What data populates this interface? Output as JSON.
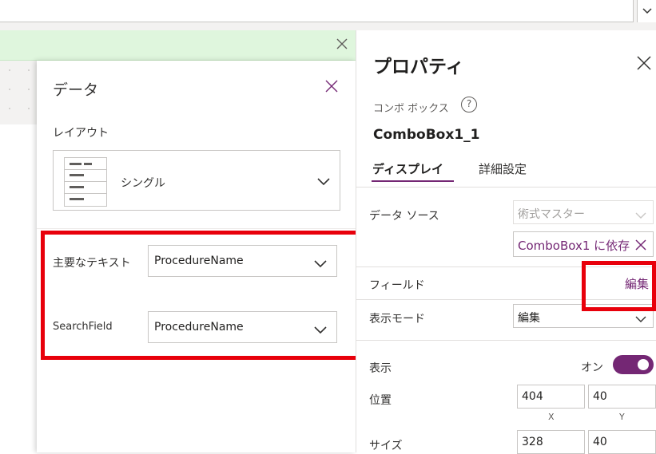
{
  "data_panel": {
    "title": "データ",
    "layout_label": "レイアウト",
    "layout_value": "シングル",
    "fields": [
      {
        "label": "主要なテキスト",
        "value": "ProcedureName"
      },
      {
        "label": "SearchField",
        "value": "ProcedureName"
      }
    ]
  },
  "properties": {
    "title": "プロパティ",
    "control_type": "コンボ ボックス",
    "control_name": "ComboBox1_1",
    "tabs": [
      "ディスプレイ",
      "詳細設定"
    ],
    "data_source_label": "データ ソース",
    "data_source_value": "術式マスター",
    "dependency_tag": "ComboBox1 に依存",
    "fields_label": "フィールド",
    "fields_edit": "編集",
    "display_mode_label": "表示モード",
    "display_mode_value": "編集",
    "visible_label": "表示",
    "visible_toggle": "オン",
    "position_label": "位置",
    "position_x": "404",
    "position_y": "40",
    "x_label": "X",
    "y_label": "Y",
    "size_label": "サイズ",
    "size_w": "328",
    "size_h": "40"
  },
  "colors": {
    "accent": "#742774",
    "highlight": "#e8000b",
    "banner": "#dff6dd"
  }
}
